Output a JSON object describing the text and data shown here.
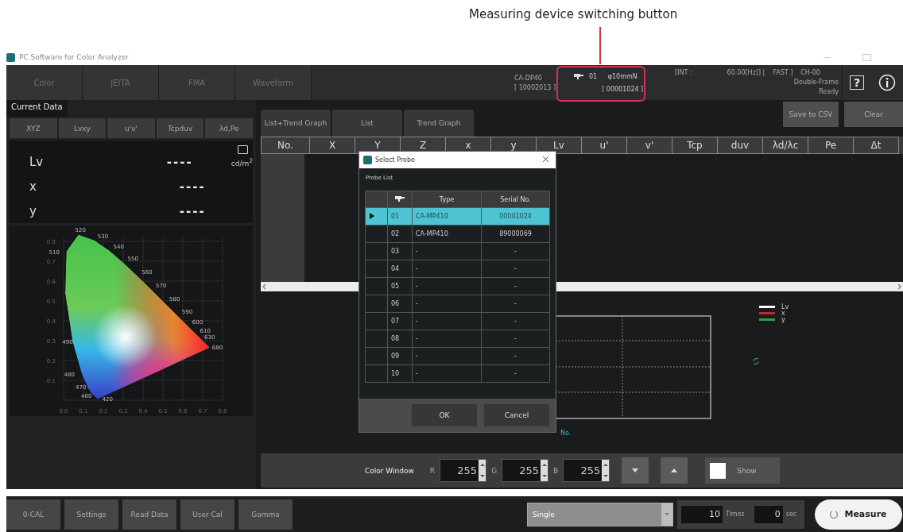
{
  "annotation": {
    "text": "Measuring device switching button"
  },
  "window": {
    "title": "PC Software for Color Analyzer"
  },
  "mode_tabs": [
    {
      "label": "Color"
    },
    {
      "label": "JEITA"
    },
    {
      "label": "FMA"
    },
    {
      "label": "Waveform"
    }
  ],
  "device": {
    "model": "CA-DP40",
    "serial": "[ 10002013 ]"
  },
  "probe_button": {
    "number": "01",
    "probe": "φ10mmN",
    "serial": "[ 00001024 ]"
  },
  "status": {
    "integration": "[INT :",
    "frequency": "60.00[Hz]] |",
    "speed": "FAST ]",
    "channel": "CH-00",
    "mode": "Double-Frame",
    "state": "Ready"
  },
  "help_button": {
    "label": "?"
  },
  "current_data": {
    "title": "Current Data",
    "tabs": [
      {
        "label": "XYZ"
      },
      {
        "label": "Lvxy"
      },
      {
        "label": "u'v'"
      },
      {
        "label": "Tcpduv"
      },
      {
        "label": "λd,Pe"
      }
    ],
    "readouts": [
      {
        "label": "Lv",
        "value": "----",
        "unit": "cd/m$^{2}$"
      },
      {
        "label": "x",
        "value": "----"
      },
      {
        "label": "y",
        "value": "----"
      }
    ]
  },
  "chromaticity_diagram": {
    "x_ticks": [
      "0.0",
      "0.1",
      "0.2",
      "0.3",
      "0.4",
      "0.5",
      "0.6",
      "0.7",
      "0.8"
    ],
    "y_ticks": [
      "0.8",
      "0.7",
      "0.6",
      "0.5",
      "0.4",
      "0.3",
      "0.2",
      "0.1"
    ],
    "wavelengths": [
      "420",
      "460",
      "470",
      "480",
      "490",
      "510",
      "520",
      "530",
      "540",
      "550",
      "560",
      "570",
      "580",
      "590",
      "600",
      "610",
      "630",
      "680"
    ]
  },
  "view_tabs": [
    {
      "label": "List+Trend Graph"
    },
    {
      "label": "List"
    },
    {
      "label": "Trend Graph"
    }
  ],
  "actions": [
    {
      "label": "Save to CSV",
      "disabled": true
    },
    {
      "label": "Clear",
      "disabled": true
    }
  ],
  "table": {
    "columns": [
      "No.",
      "X",
      "Y",
      "Z",
      "x",
      "y",
      "Lv",
      "u'",
      "v'",
      "Tcp",
      "duv",
      "λd/λc",
      "Pe",
      "Δt"
    ]
  },
  "trend_graph": {
    "legend": [
      {
        "label": "Lv",
        "color": "#ffffff"
      },
      {
        "label": "x",
        "color": "#c0282d"
      },
      {
        "label": "y",
        "color": "#3a9a40"
      }
    ],
    "axis_label": "No."
  },
  "color_window": {
    "label": "Color Window",
    "channels": [
      {
        "name": "R",
        "value": "255"
      },
      {
        "name": "G",
        "value": "255"
      },
      {
        "name": "B",
        "value": "255"
      }
    ],
    "show": {
      "label": "Show",
      "disabled": true
    }
  },
  "bottom_buttons": [
    {
      "label": "0-CAL",
      "disabled": true
    },
    {
      "label": "Settings",
      "disabled": true
    },
    {
      "label": "Read Data",
      "disabled": true
    },
    {
      "label": "User Cal",
      "disabled": true
    },
    {
      "label": "Gamma",
      "disabled": true
    }
  ],
  "measure_mode": {
    "value": "Single"
  },
  "count": {
    "value": "10",
    "unit": "Times"
  },
  "interval": {
    "value": "0",
    "unit": "sec"
  },
  "measure_button": {
    "label": "Measure"
  },
  "dialog": {
    "title": "Select Probe",
    "group": "Probe List",
    "columns": [
      "Type",
      "Serial No."
    ],
    "rows": [
      {
        "number": "01",
        "type": "CA-MP410",
        "serial": "00001024",
        "selected": true
      },
      {
        "number": "02",
        "type": "CA-MP410",
        "serial": "89000069",
        "selected": false
      },
      {
        "number": "03",
        "type": "-",
        "serial": "-",
        "selected": false
      },
      {
        "number": "04",
        "type": "-",
        "serial": "-",
        "selected": false
      },
      {
        "number": "05",
        "type": "-",
        "serial": "-",
        "selected": false
      },
      {
        "number": "06",
        "type": "-",
        "serial": "-",
        "selected": false
      },
      {
        "number": "07",
        "type": "-",
        "serial": "-",
        "selected": false
      },
      {
        "number": "08",
        "type": "-",
        "serial": "-",
        "selected": false
      },
      {
        "number": "09",
        "type": "-",
        "serial": "-",
        "selected": false
      },
      {
        "number": "10",
        "type": "-",
        "serial": "-",
        "selected": false
      }
    ],
    "buttons": [
      {
        "label": "OK"
      },
      {
        "label": "Cancel"
      }
    ]
  }
}
